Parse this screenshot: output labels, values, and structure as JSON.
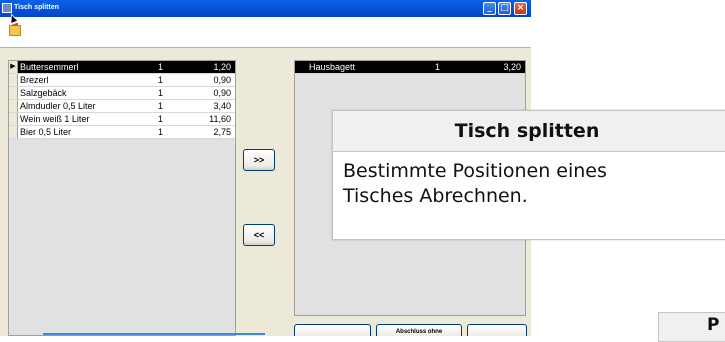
{
  "window": {
    "title": "Tisch splitten"
  },
  "left_grid": {
    "rows": [
      {
        "item": "Buttersemmerl",
        "qty": "1",
        "price": "1,20",
        "selected": true
      },
      {
        "item": "Brezerl",
        "qty": "1",
        "price": "0,90"
      },
      {
        "item": "Salzgebäck",
        "qty": "1",
        "price": "0,90"
      },
      {
        "item": "Almdudler 0,5 Liter",
        "qty": "1",
        "price": "3,40"
      },
      {
        "item": "Wein weiß 1 Liter",
        "qty": "1",
        "price": "11,60"
      },
      {
        "item": "Bier  0,5 Liter",
        "qty": "1",
        "price": "2,75"
      }
    ]
  },
  "right_grid": {
    "rows": [
      {
        "item": "Hausbagett",
        "qty": "1",
        "price": "3,20",
        "selected": true
      }
    ]
  },
  "buttons": {
    "move_right": ">>",
    "move_left": "<<",
    "bottom_left": "",
    "bottom_middle": "Abschluss ohne",
    "bottom_right": ""
  },
  "tooltip": {
    "title": "Tisch splitten",
    "body_line1": "Bestimmte Positionen eines",
    "body_line2": "Tisches Abrechnen."
  },
  "partial_tooltip": {
    "text": "P"
  }
}
